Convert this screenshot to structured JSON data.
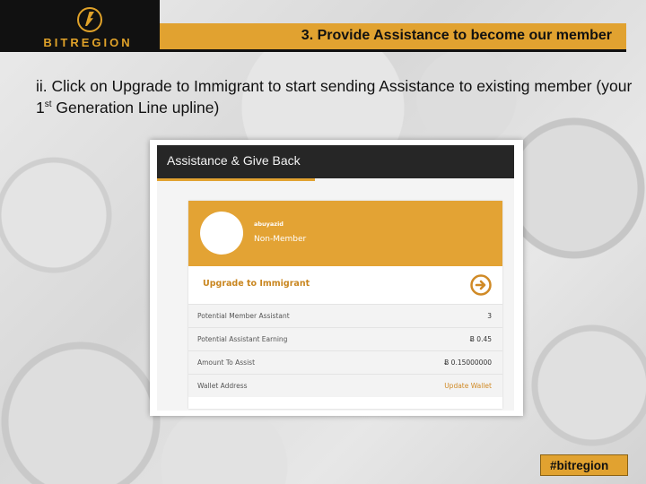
{
  "brand": {
    "logo_text": "BITREGION"
  },
  "slide": {
    "title": "3. Provide Assistance to become our member",
    "instruction_part1": "ii. Click on Upgrade to Immigrant to start sending Assistance to existing member (your 1",
    "instruction_sup": "st",
    "instruction_part2": " Generation Line upline)",
    "hashtag": "#bitregion"
  },
  "panel": {
    "title": "Assistance & Give Back",
    "profile": {
      "username": "abuyazid",
      "status": "Non-Member"
    },
    "upgrade_label": "Upgrade to Immigrant",
    "rows": [
      {
        "label": "Potential Member Assistant",
        "value": "3"
      },
      {
        "label": "Potential Assistant Earning",
        "value": "Ƀ 0.45"
      },
      {
        "label": "Amount To Assist",
        "value": "Ƀ 0.15000000"
      },
      {
        "label": "Wallet Address",
        "value": "Update Wallet"
      }
    ]
  },
  "colors": {
    "accent": "#e1a230",
    "header_dark": "#262626",
    "link": "#d08a26"
  },
  "icons": {
    "logo": "lightning-circle-icon",
    "upgrade": "arrow-right-circle-icon"
  }
}
